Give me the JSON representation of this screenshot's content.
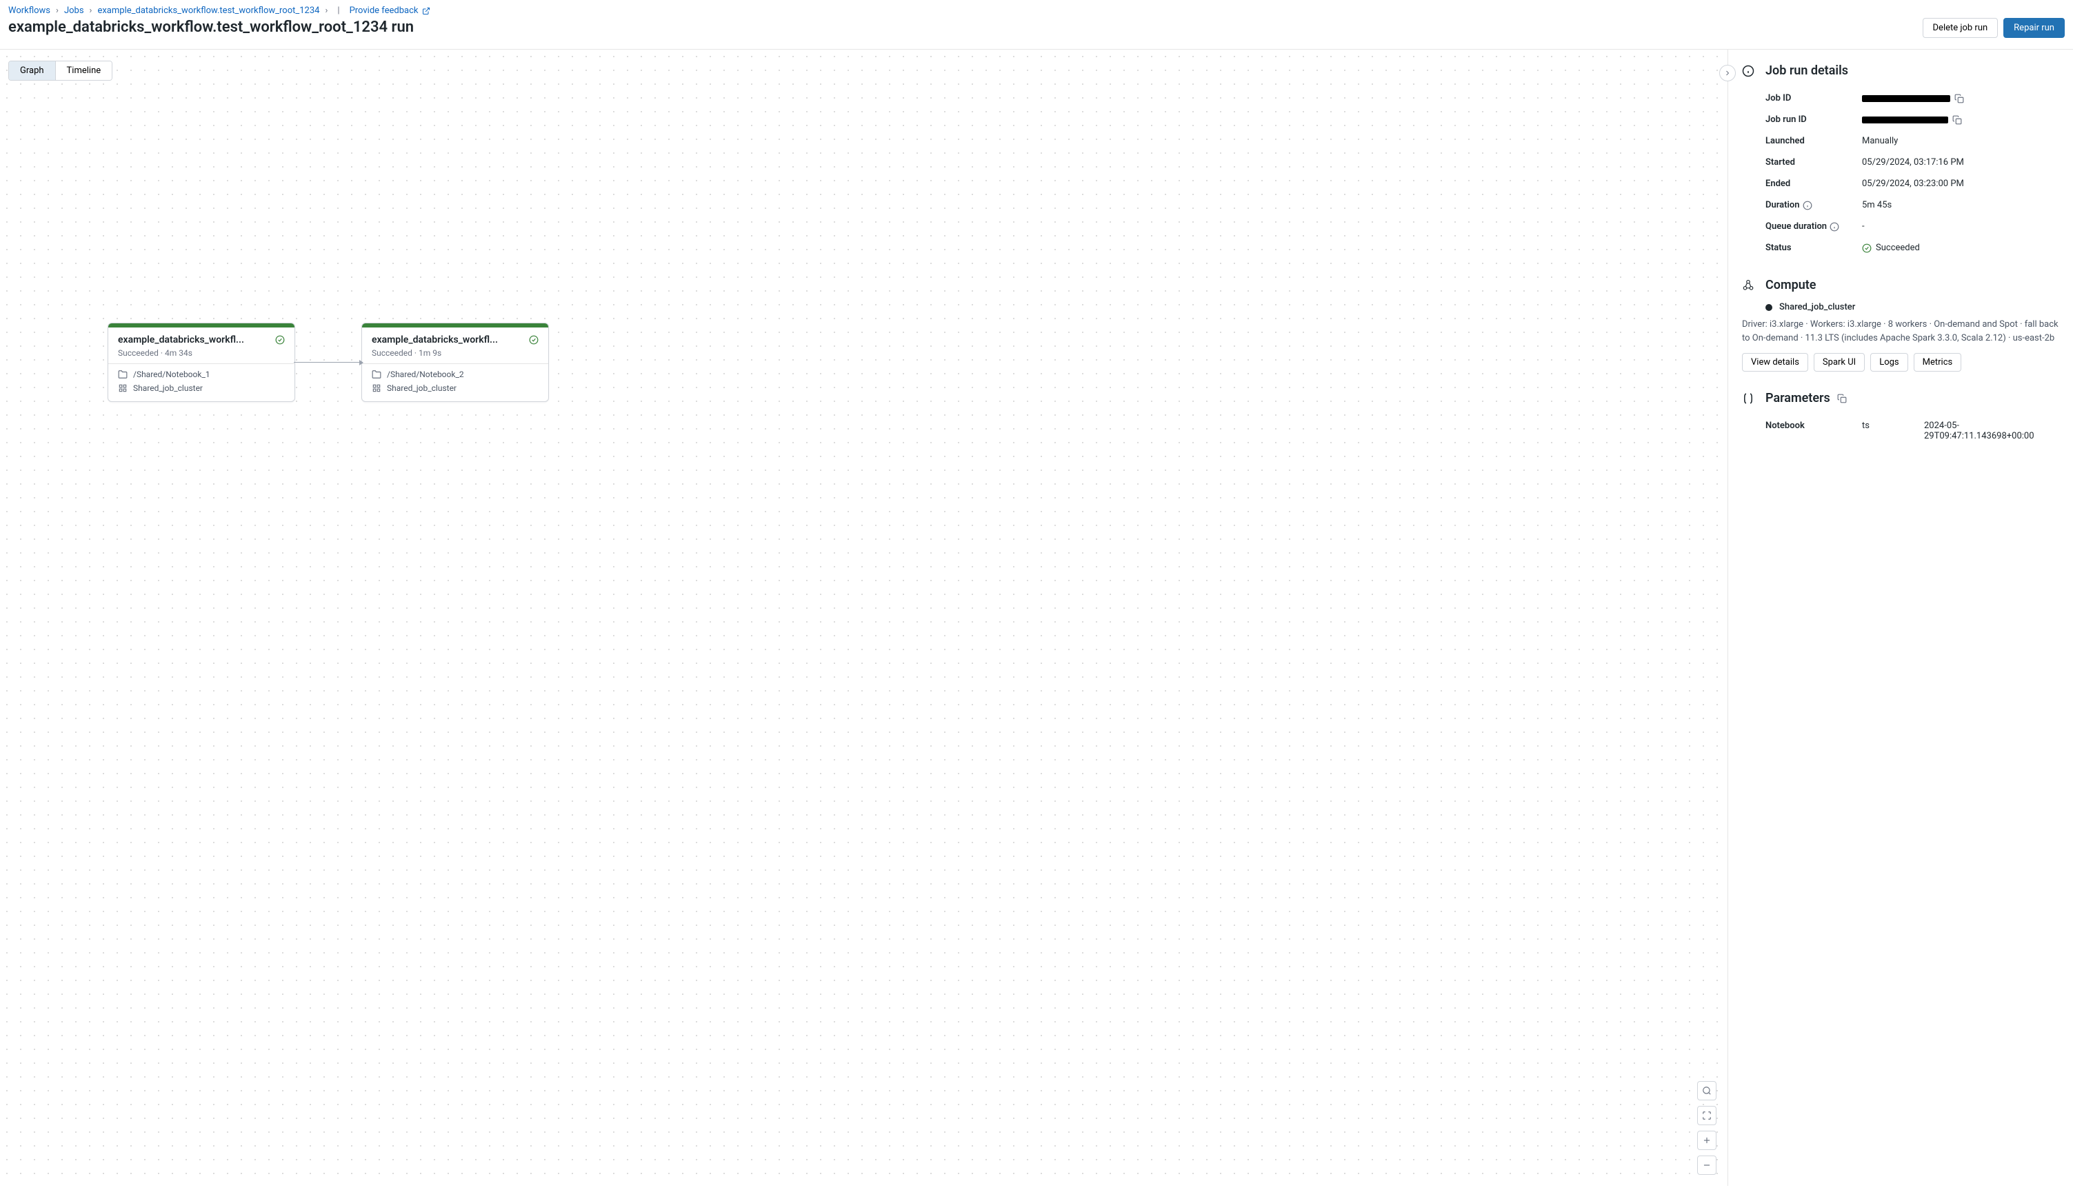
{
  "breadcrumb": {
    "l1": "Workflows",
    "l2": "Jobs",
    "l3": "example_databricks_workflow.test_workflow_root_1234",
    "feedback": "Provide feedback"
  },
  "page_title": "example_databricks_workflow.test_workflow_root_1234 run",
  "actions": {
    "delete": "Delete job run",
    "repair": "Repair run"
  },
  "view_toggle": {
    "graph": "Graph",
    "timeline": "Timeline"
  },
  "nodes": [
    {
      "title": "example_databricks_workfl...",
      "status": "Succeeded · 4m 34s",
      "path": "/Shared/Notebook_1",
      "cluster": "Shared_job_cluster"
    },
    {
      "title": "example_databricks_workfl...",
      "status": "Succeeded · 1m 9s",
      "path": "/Shared/Notebook_2",
      "cluster": "Shared_job_cluster"
    }
  ],
  "details": {
    "title": "Job run details",
    "job_id_label": "Job ID",
    "job_id_value": "████████████████",
    "job_run_id_label": "Job run ID",
    "job_run_id_value": "████████████████",
    "launched_label": "Launched",
    "launched_value": "Manually",
    "started_label": "Started",
    "started_value": "05/29/2024, 03:17:16 PM",
    "ended_label": "Ended",
    "ended_value": "05/29/2024, 03:23:00 PM",
    "duration_label": "Duration",
    "duration_value": "5m 45s",
    "queue_label": "Queue duration",
    "queue_value": "-",
    "status_label": "Status",
    "status_value": "Succeeded"
  },
  "compute": {
    "title": "Compute",
    "cluster_name": "Shared_job_cluster",
    "desc": "Driver: i3.xlarge · Workers: i3.xlarge · 8 workers · On-demand and Spot · fall back to On-demand · 11.3 LTS (includes Apache Spark 3.3.0, Scala 2.12) · us-east-2b",
    "buttons": {
      "view": "View details",
      "spark": "Spark UI",
      "logs": "Logs",
      "metrics": "Metrics"
    }
  },
  "parameters": {
    "title": "Parameters",
    "type_label": "Notebook",
    "key": "ts",
    "value": "2024-05-29T09:47:11.143698+00:00"
  }
}
